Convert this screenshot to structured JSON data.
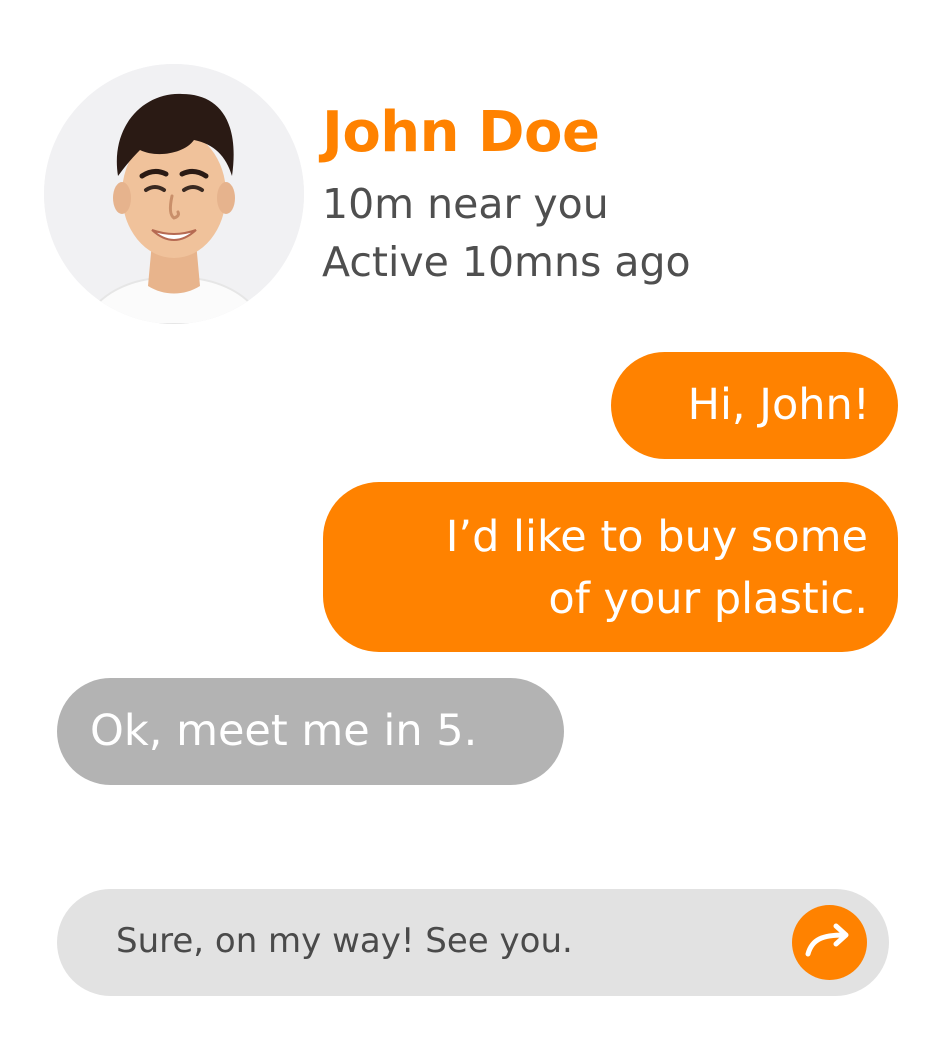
{
  "profile": {
    "name": "John Doe",
    "distance": "10m near you",
    "active": "Active 10mns ago",
    "avatar_icon": "user-photo"
  },
  "messages": [
    {
      "direction": "outgoing",
      "lines": [
        "Hi, John!"
      ]
    },
    {
      "direction": "outgoing",
      "lines": [
        "I’d like to buy some",
        "of your plastic."
      ]
    },
    {
      "direction": "incoming",
      "lines": [
        "Ok, meet me in 5."
      ]
    }
  ],
  "composer": {
    "value": "Sure, on my way! See you.",
    "send_icon": "send-arrow-icon"
  },
  "colors": {
    "accent": "#ff8200",
    "incoming_bubble": "#b3b3b3",
    "composer_bg": "#e2e2e2",
    "secondary_text": "#4f4f4f"
  }
}
